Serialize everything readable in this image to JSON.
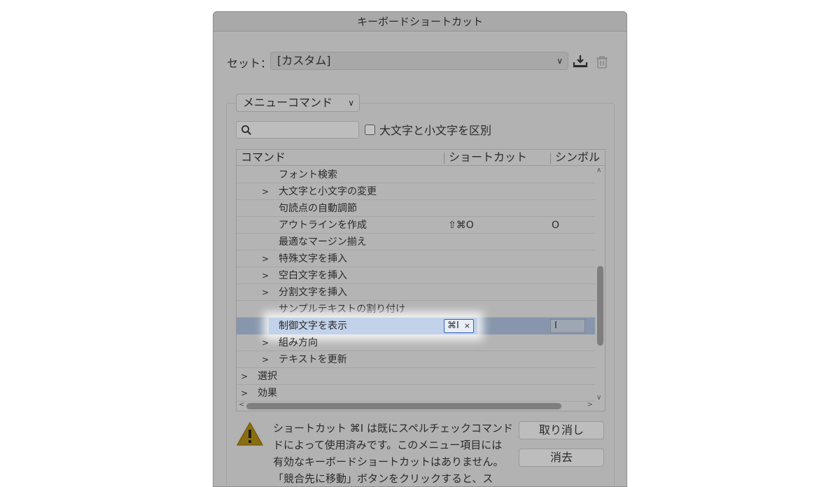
{
  "dialog": {
    "title": "キーボードショートカット",
    "set_label": "セット：",
    "set_value": "[カスタム]",
    "menu_type": "メニューコマンド",
    "search_placeholder": "",
    "case_checkbox_label": "大文字と小文字を区別",
    "case_checked": false
  },
  "table": {
    "headers": [
      "コマンド",
      "ショートカット",
      "シンボル"
    ],
    "rows": [
      {
        "label": "フォント検索",
        "expandable": false,
        "level": 1,
        "shortcut": "",
        "symbol": ""
      },
      {
        "label": "大文字と小文字の変更",
        "expandable": true,
        "level": 1,
        "shortcut": "",
        "symbol": ""
      },
      {
        "label": "句読点の自動調節",
        "expandable": false,
        "level": 1,
        "shortcut": "",
        "symbol": ""
      },
      {
        "label": "アウトラインを作成",
        "expandable": false,
        "level": 1,
        "shortcut": "⇧⌘O",
        "symbol": "O"
      },
      {
        "label": "最適なマージン揃え",
        "expandable": false,
        "level": 1,
        "shortcut": "",
        "symbol": ""
      },
      {
        "label": "特殊文字を挿入",
        "expandable": true,
        "level": 1,
        "shortcut": "",
        "symbol": ""
      },
      {
        "label": "空白文字を挿入",
        "expandable": true,
        "level": 1,
        "shortcut": "",
        "symbol": ""
      },
      {
        "label": "分割文字を挿入",
        "expandable": true,
        "level": 1,
        "shortcut": "",
        "symbol": ""
      },
      {
        "label": "サンプルテキストの割り付け",
        "expandable": false,
        "level": 1,
        "shortcut": "",
        "symbol": ""
      },
      {
        "label": "制御文字を表示",
        "expandable": false,
        "level": 1,
        "shortcut": "⌘I",
        "symbol": "I",
        "selected": true
      },
      {
        "label": "組み方向",
        "expandable": true,
        "level": 1,
        "shortcut": "",
        "symbol": ""
      },
      {
        "label": "テキストを更新",
        "expandable": true,
        "level": 1,
        "shortcut": "",
        "symbol": ""
      },
      {
        "label": "選択",
        "expandable": true,
        "level": 0,
        "shortcut": "",
        "symbol": ""
      },
      {
        "label": "効果",
        "expandable": true,
        "level": 0,
        "shortcut": "",
        "symbol": ""
      }
    ],
    "clear_glyph": "×"
  },
  "warning": {
    "lines": [
      "ショートカット ⌘I は既にスペルチェックコマンド",
      "ドによって使用済みです。このメニュー項目には",
      "有効なキーボードショートカットはありません。",
      "「競合先に移動」ボタンをクリックすると、ス"
    ]
  },
  "buttons": {
    "undo": "取り消し",
    "clear": "消去"
  },
  "icons": {
    "chevron": "chevron-down-icon",
    "save": "save-set-icon",
    "delete": "trash-icon",
    "search": "search-icon",
    "warning": "warning-triangle-icon"
  }
}
